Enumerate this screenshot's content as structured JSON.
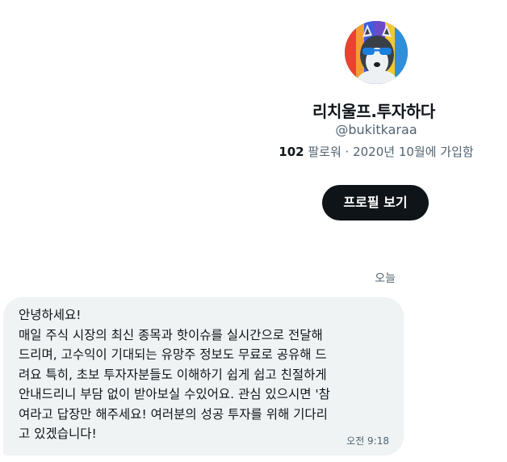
{
  "profile": {
    "display_name": "리치울프.투자하다",
    "handle": "@bukitkaraa",
    "followers_count": "102",
    "followers_label": " 팔로워 · 2020년 10월에 가입함",
    "view_profile_label": "프로필 보기",
    "avatar_icon": "husky-sunglasses-avatar"
  },
  "conversation": {
    "day_label": "오늘",
    "message": {
      "text": "안녕하세요!\n매일 주식 시장의 최신 종목과 핫이슈를 실시간으로 전달해\n드리며, 고수익이 기대되는 유망주 정보도 무료로 공유해 드\n려요 특히, 초보 투자자분들도 이해하기 쉽게 쉽고 친절하게\n안내드리니 부담 없이 받아보실 수있어요. 관심 있으시면 '참\n여라고 답장만 해주세요! 여러분의 성공 투자를 위해 기다리\n고 있겠습니다!",
      "time": "오전 9:18"
    }
  },
  "colors": {
    "text_primary": "#0f1419",
    "text_secondary": "#536471",
    "bubble_bg": "#eff3f4",
    "button_bg": "#0f1419"
  }
}
